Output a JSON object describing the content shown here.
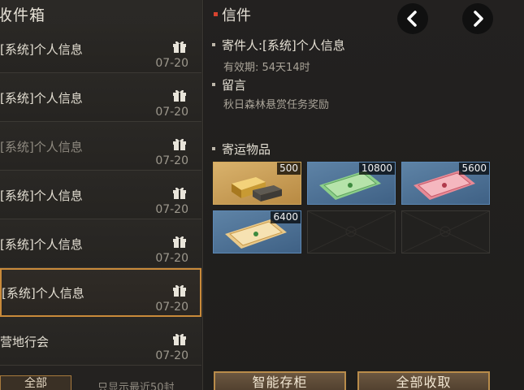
{
  "inbox": {
    "title": "收件箱",
    "items": [
      {
        "subject": "[系统]个人信息",
        "date": "07-20",
        "icon": "gift-icon"
      },
      {
        "subject": "[系统]个人信息",
        "date": "07-20",
        "icon": "gift-icon"
      },
      {
        "subject": "[系统]个人信息",
        "date": "07-20",
        "icon": "gift-icon"
      },
      {
        "subject": "[系统]个人信息",
        "date": "07-20",
        "icon": "gift-icon"
      },
      {
        "subject": "[系统]个人信息",
        "date": "07-20",
        "icon": "gift-icon"
      },
      {
        "subject": "[系统]个人信息",
        "date": "07-20",
        "icon": "gift-icon"
      },
      {
        "subject": "营地行会",
        "date": "07-20",
        "icon": "gift-icon"
      }
    ],
    "all_button_label": "全部",
    "footer_note": "只显示最近50封"
  },
  "detail": {
    "title": "信件",
    "sender_label": "寄件人:[系统]个人信息",
    "validity": "有效期: 54天14时",
    "message_label": "留言",
    "message_text": "秋日森林悬赏任务奖励",
    "attachments_label": "寄运物品",
    "attachments": [
      {
        "icon": "gold-bars-icon",
        "quantity": "500"
      },
      {
        "icon": "green-voucher-icon",
        "quantity": "10800"
      },
      {
        "icon": "red-voucher-icon",
        "quantity": "5600"
      },
      {
        "icon": "yellow-voucher-icon",
        "quantity": "6400"
      }
    ],
    "store_button_label": "智能存柜",
    "claim_all_button_label": "全部收取"
  },
  "nav": {
    "prev_icon": "chevron-left-icon",
    "next_icon": "chevron-right-icon"
  },
  "colors": {
    "selected_border": "#c98a3a",
    "accent_red": "#d8432f",
    "slot_blue": "#5c88b5",
    "slot_gold": "#d2a85c"
  }
}
